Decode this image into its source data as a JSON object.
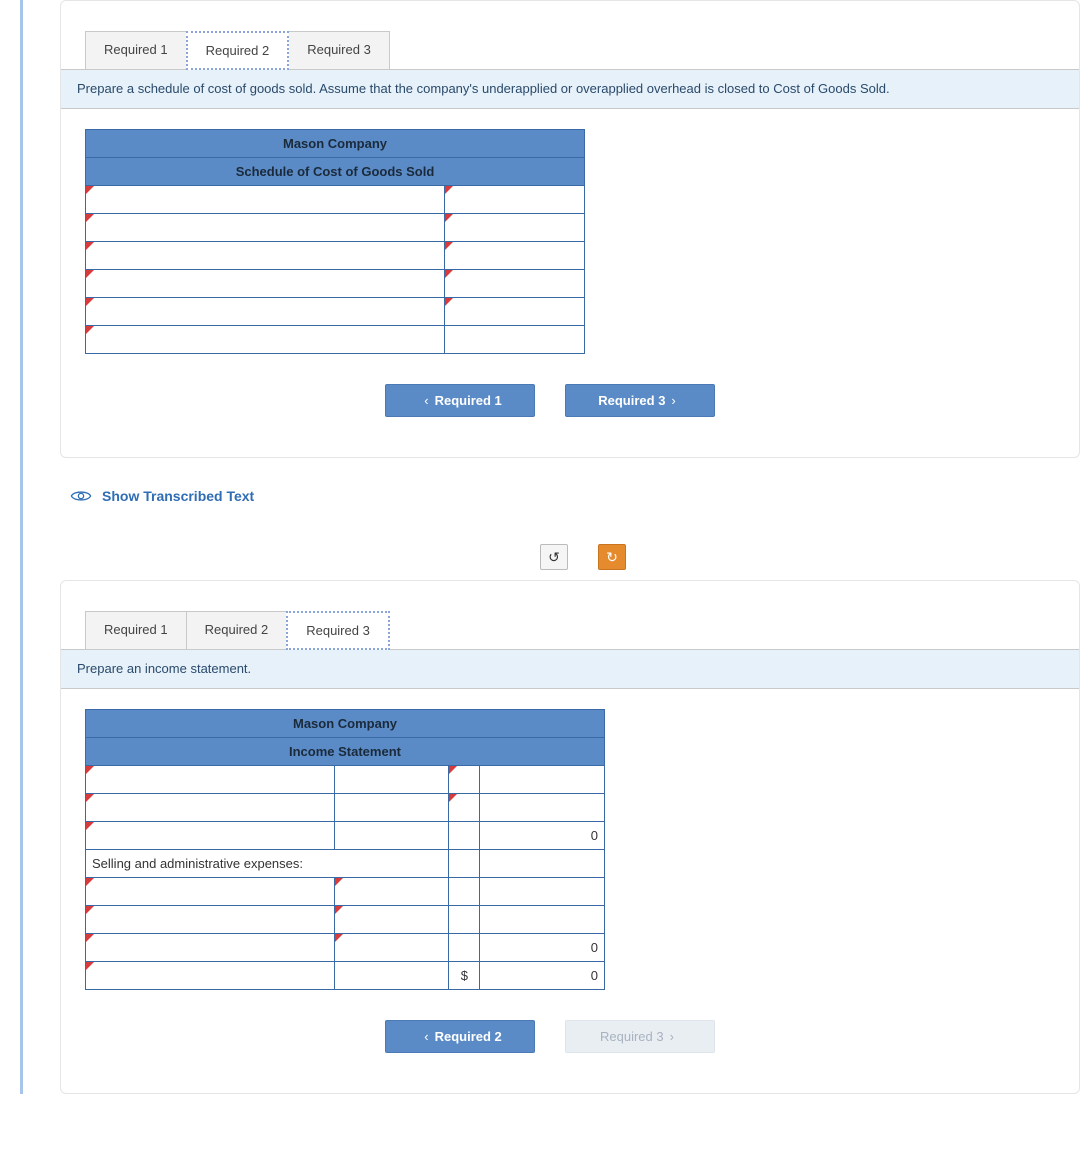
{
  "section1": {
    "tabs": [
      "Required 1",
      "Required 2",
      "Required 3"
    ],
    "activeTab": 1,
    "instruction": "Prepare a schedule of cost of goods sold. Assume that the company's underapplied or overapplied overhead is closed to Cost of Goods Sold.",
    "header1": "Mason Company",
    "header2": "Schedule of Cost of Goods Sold",
    "navPrev": "Required 1",
    "navNext": "Required 3"
  },
  "transcribedLink": "Show Transcribed Text",
  "section2": {
    "tabs": [
      "Required 1",
      "Required 2",
      "Required 3"
    ],
    "activeTab": 2,
    "instruction": "Prepare an income statement.",
    "header1": "Mason Company",
    "header2": "Income Statement",
    "rowLabel": "Selling and administrative expenses:",
    "currencySymbol": "$",
    "zeroVal": "0",
    "navPrev": "Required 2",
    "navNext": "Required 3"
  }
}
